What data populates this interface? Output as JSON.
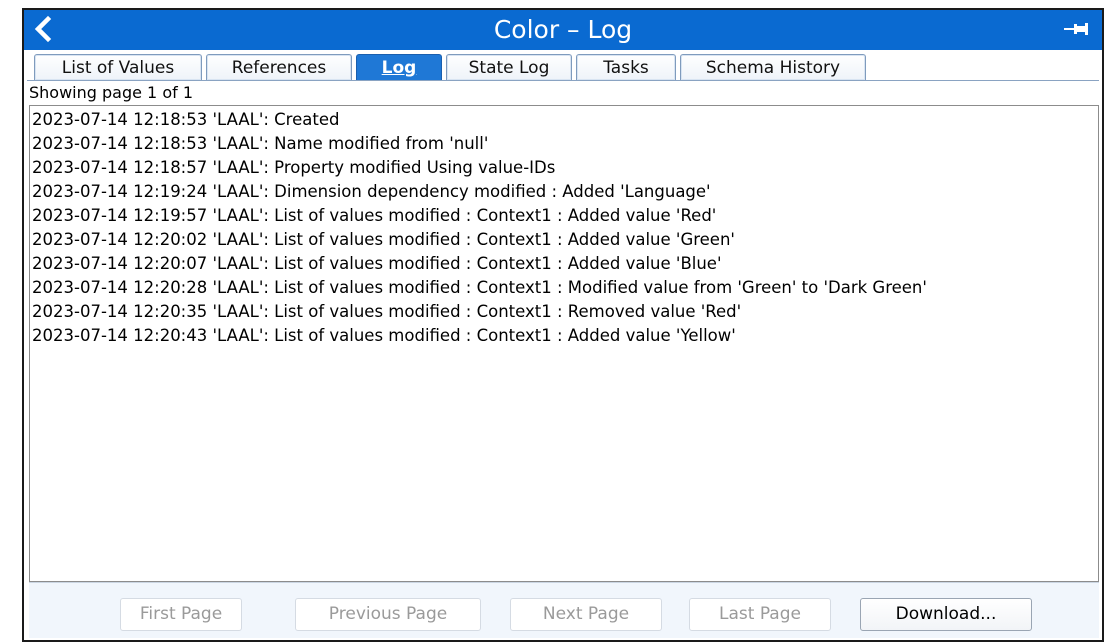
{
  "window": {
    "title": "Color – Log"
  },
  "tabs": [
    {
      "label": "List of Values"
    },
    {
      "label": "References"
    },
    {
      "label": "Log"
    },
    {
      "label": "State Log"
    },
    {
      "label": "Tasks"
    },
    {
      "label": "Schema History"
    }
  ],
  "active_tab": "Log",
  "page_info": "Showing page 1 of 1",
  "log": [
    "2023-07-14 12:18:53 'LAAL': Created",
    "2023-07-14 12:18:53 'LAAL': Name modified from 'null'",
    "2023-07-14 12:18:57 'LAAL': Property modified Using value-IDs",
    "2023-07-14 12:19:24 'LAAL': Dimension dependency modified : Added 'Language'",
    "2023-07-14 12:19:57 'LAAL': List of values modified : Context1 : Added value 'Red'",
    "2023-07-14 12:20:02 'LAAL': List of values modified : Context1 : Added value 'Green'",
    "2023-07-14 12:20:07 'LAAL': List of values modified : Context1 : Added value 'Blue'",
    "2023-07-14 12:20:28 'LAAL': List of values modified : Context1 : Modified value from 'Green' to 'Dark Green'",
    "2023-07-14 12:20:35 'LAAL': List of values modified : Context1 : Removed value 'Red'",
    "2023-07-14 12:20:43 'LAAL': List of values modified : Context1 : Added value 'Yellow'"
  ],
  "buttons": {
    "first_page": "First Page",
    "previous_page": "Previous Page",
    "next_page": "Next Page",
    "last_page": "Last Page",
    "download": "Download..."
  },
  "colors": {
    "titlebar": "#0a6ad1",
    "active_tab": "#1f78d6"
  },
  "icons": {
    "back": "chevron-left-icon",
    "pin": "pin-icon"
  }
}
